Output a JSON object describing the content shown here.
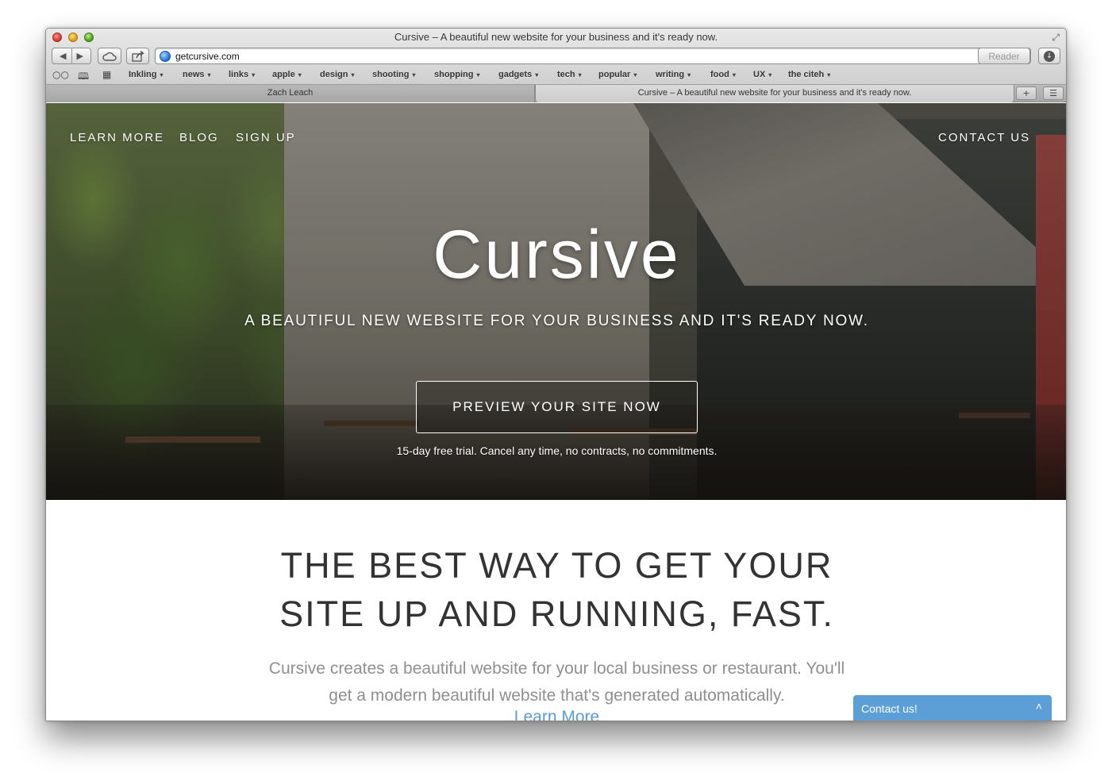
{
  "window": {
    "title": "Cursive – A beautiful new website for your business and it's ready now."
  },
  "toolbar": {
    "back": "◀",
    "forward": "▶",
    "icloud_icon": "cloud-icon",
    "share_icon": "share-icon",
    "url": "getcursive.com",
    "reload_glyph": "↻",
    "reader_label": "Reader",
    "download_glyph": "↓"
  },
  "bookmarks": {
    "items": [
      {
        "label": "Inkling"
      },
      {
        "label": "news"
      },
      {
        "label": "links"
      },
      {
        "label": "apple"
      },
      {
        "label": "design"
      },
      {
        "label": "shooting"
      },
      {
        "label": "shopping"
      },
      {
        "label": "gadgets"
      },
      {
        "label": "tech"
      },
      {
        "label": "popular"
      },
      {
        "label": "writing"
      },
      {
        "label": "food"
      },
      {
        "label": "UX"
      },
      {
        "label": "the citeh"
      }
    ],
    "caret": "▾"
  },
  "tabs": [
    {
      "label": "Zach Leach",
      "active": false
    },
    {
      "label": "Cursive – A beautiful new website for your business and it's ready now.",
      "active": true
    }
  ],
  "tab_controls": {
    "plus": "+",
    "list": "☰"
  },
  "site": {
    "nav": {
      "learn_more": "LEARN MORE",
      "blog": "BLOG",
      "sign_up": "SIGN UP",
      "contact_us": "CONTACT US"
    },
    "hero": {
      "title": "Cursive",
      "subtitle": "A BEAUTIFUL NEW WEBSITE FOR YOUR BUSINESS AND IT'S READY NOW.",
      "cta": "PREVIEW YOUR SITE NOW",
      "trial": "15-day free trial. Cancel any time, no contracts, no commitments."
    },
    "section": {
      "headline_line1": "THE BEST WAY TO GET YOUR",
      "headline_line2": "SITE UP AND RUNNING, FAST.",
      "desc_line1": "Cursive creates a beautiful website for your local business or restaurant. You'll",
      "desc_line2": "get a modern beautiful website that's generated automatically.",
      "learn_more": "Learn More"
    },
    "contact_widget": {
      "label": "Contact us!",
      "chevron": "˄"
    }
  },
  "colors": {
    "accent": "#5b9fd6",
    "link": "#5a9bd5",
    "headline": "#333333",
    "body_text": "#8f8f8f"
  }
}
